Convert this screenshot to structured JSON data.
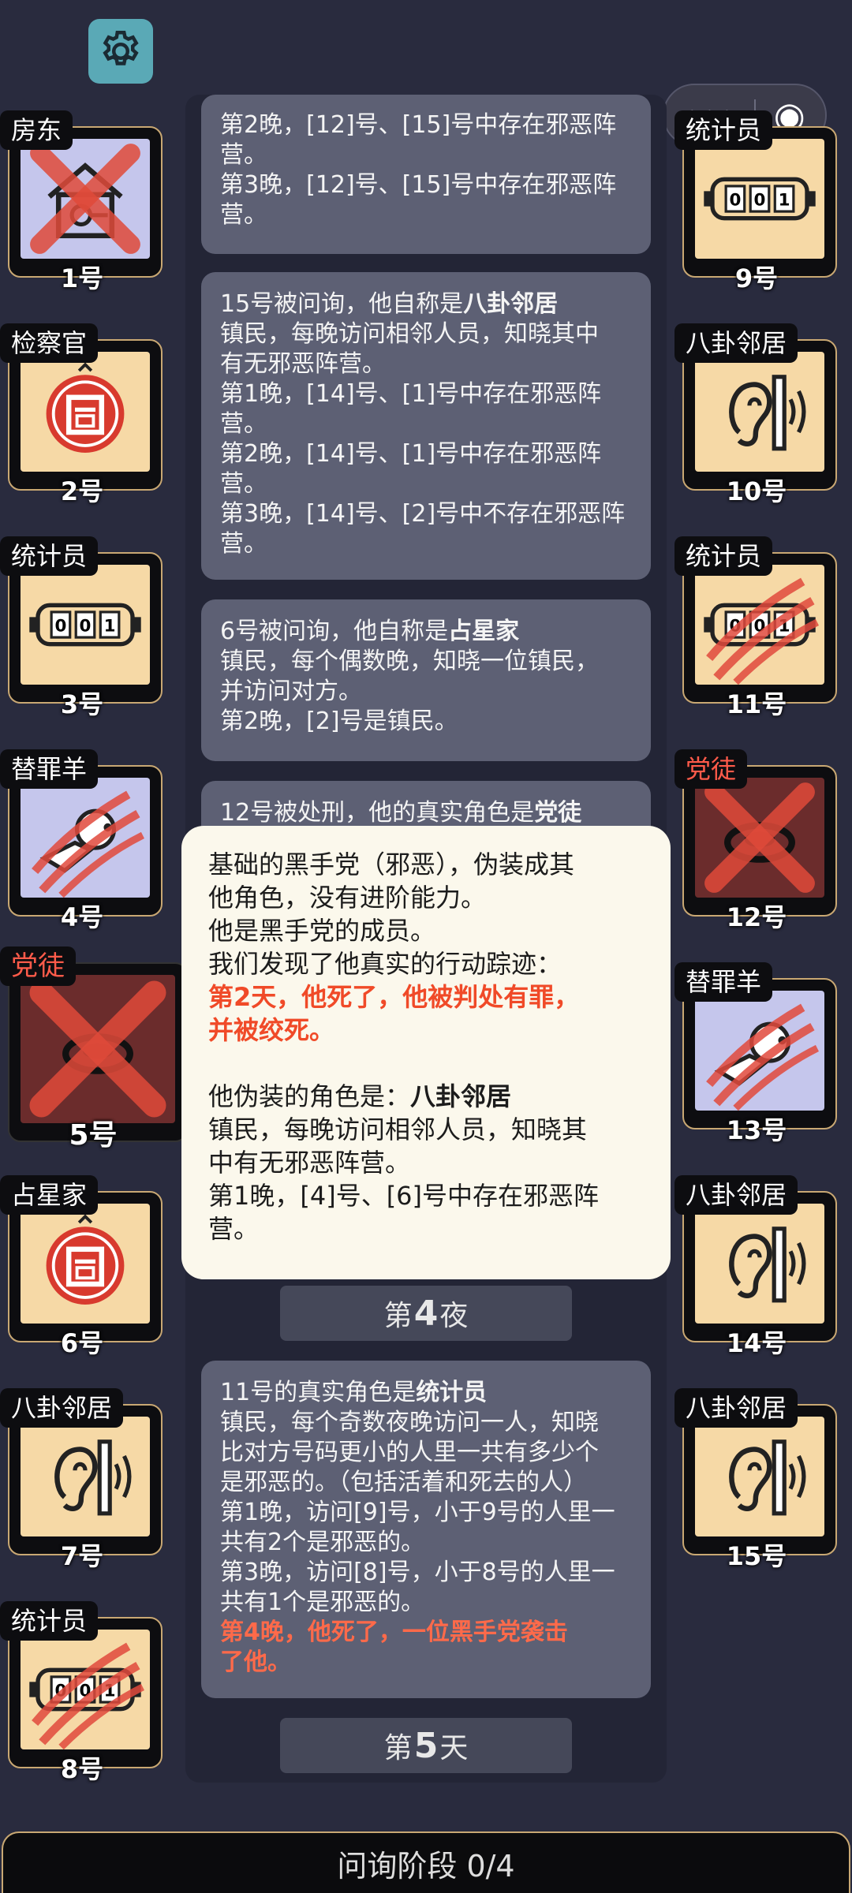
{
  "top": {
    "settings_icon": "gear-icon",
    "capsule_more": "•••",
    "capsule_close": "◉"
  },
  "left_players": [
    {
      "role": "房东",
      "num": "1号",
      "style": "blue",
      "icon": "house-key-icon",
      "mark": "cross",
      "tag_color": "white"
    },
    {
      "role": "检察官",
      "num": "2号",
      "style": "tan",
      "icon": "stamp-icon",
      "mark": "",
      "tag_color": "white"
    },
    {
      "role": "统计员",
      "num": "3号",
      "style": "tan",
      "icon": "counter-icon",
      "mark": "",
      "tag_color": "white"
    },
    {
      "role": "替罪羊",
      "num": "4号",
      "style": "blue",
      "icon": "sheep-icon",
      "mark": "claw",
      "tag_color": "white"
    },
    {
      "role": "党徒",
      "num": "5号",
      "style": "dark",
      "icon": "ring-icon",
      "mark": "cross",
      "tag_color": "red"
    },
    {
      "role": "占星家",
      "num": "6号",
      "style": "tan",
      "icon": "stamp-icon",
      "mark": "",
      "tag_color": "white"
    },
    {
      "role": "八卦邻居",
      "num": "7号",
      "style": "tan",
      "icon": "ear-icon",
      "mark": "",
      "tag_color": "white"
    },
    {
      "role": "统计员",
      "num": "8号",
      "style": "tan",
      "icon": "counter-icon",
      "mark": "claw",
      "tag_color": "white"
    }
  ],
  "right_players": [
    {
      "role": "统计员",
      "num": "9号",
      "style": "tan",
      "icon": "counter-icon",
      "mark": "",
      "tag_color": "white"
    },
    {
      "role": "八卦邻居",
      "num": "10号",
      "style": "tan",
      "icon": "ear-icon",
      "mark": "",
      "tag_color": "white"
    },
    {
      "role": "统计员",
      "num": "11号",
      "style": "tan",
      "icon": "counter-icon",
      "mark": "claw",
      "tag_color": "white"
    },
    {
      "role": "党徒",
      "num": "12号",
      "style": "dark",
      "icon": "ring-icon",
      "mark": "cross",
      "tag_color": "red"
    },
    {
      "role": "替罪羊",
      "num": "13号",
      "style": "blue",
      "icon": "sheep-icon",
      "mark": "claw",
      "tag_color": "white"
    },
    {
      "role": "八卦邻居",
      "num": "14号",
      "style": "tan",
      "icon": "ear-icon",
      "mark": "",
      "tag_color": "white"
    },
    {
      "role": "八卦邻居",
      "num": "15号",
      "style": "tan",
      "icon": "ear-icon",
      "mark": "",
      "tag_color": "white"
    }
  ],
  "log": {
    "card1": {
      "l1": "第2晚，[12]号、[15]号中存在邪恶阵",
      "l2": "营。",
      "l3": "第3晚，[12]号、[15]号中存在邪恶阵",
      "l4": "营。"
    },
    "card2": {
      "head": "15号被问询，他自称是",
      "role": "八卦邻居",
      "l1": "镇民，每晚访问相邻人员，知晓其中",
      "l2": "有无邪恶阵营。",
      "l3": "第1晚，[14]号、[1]号中存在邪恶阵",
      "l4": "营。",
      "l5": "第2晚，[14]号、[1]号中存在邪恶阵",
      "l6": "营。",
      "l7": "第3晚，[14]号、[2]号中不存在邪恶阵",
      "l8": "营。"
    },
    "card3": {
      "head": "6号被问询，他自称是",
      "role": "占星家",
      "l1": "镇民，每个偶数晚，知晓一位镇民，",
      "l2": "并访问对方。",
      "l3": "第2晚，[2]号是镇民。"
    },
    "card4": {
      "head": "12号被处刑，他的真实角色是",
      "role": "党徒"
    },
    "night4": {
      "prefix": "第",
      "num": "4",
      "suffix": "夜"
    },
    "card5": {
      "head": "11号的真实角色是",
      "role": "统计员",
      "l1": "镇民，每个奇数夜晚访问一人，知晓",
      "l2": "比对方号码更小的人里一共有多少个",
      "l3": "是邪恶的。（包括活着和死去的人）",
      "l4": "第1晚，访问[9]号，小于9号的人里一",
      "l5": "共有2个是邪恶的。",
      "l6": "第3晚，访问[8]号，小于8号的人里一",
      "l7": "共有1个是邪恶的。",
      "r1": "第4晚，他死了，一位黑手党袭击",
      "r2": "了他。"
    },
    "day5": {
      "prefix": "第",
      "num": "5",
      "suffix": "天"
    }
  },
  "popup": {
    "l1": "基础的黑手党（邪恶），伪装成其",
    "l2": "他角色，没有进阶能力。",
    "l3": "他是黑手党的成员。",
    "l4": "我们发现了他真实的行动踪迹：",
    "r1": "第2天，他死了，他被判处有罪，",
    "r2": "并被绞死。",
    "l5": "他伪装的角色是：",
    "role": "八卦邻居",
    "l6": "镇民，每晚访问相邻人员，知晓其",
    "l7": "中有无邪恶阵营。",
    "l8": "第1晚，[4]号、[6]号中存在邪恶阵",
    "l9": "营。"
  },
  "bottom": {
    "phase": "问询阶段 0/4"
  },
  "colors": {
    "bg": "#292b3e",
    "card": "#5d6074",
    "accent_red": "#ff6a4a",
    "tile_gold": "#c9a873",
    "tile_tan": "#f6d9a6",
    "tile_blue": "#c5c6ec"
  }
}
